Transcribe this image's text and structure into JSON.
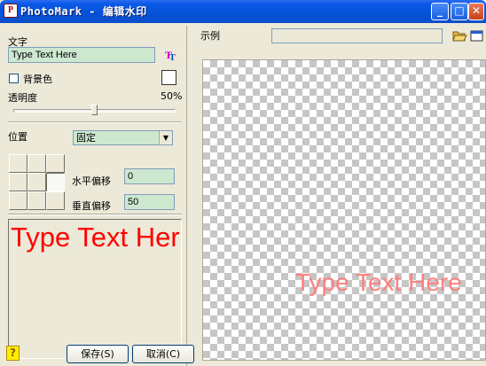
{
  "window": {
    "title": "PhotoMark - 编辑水印",
    "app_icon_letter": "P",
    "controls": {
      "minimize": "_",
      "maximize": "□",
      "close": "✕"
    }
  },
  "left": {
    "text_label": "文字",
    "text_value": "Type Text Here",
    "font_icon": "font-color-icon",
    "bg_color_label": "背景色",
    "bg_color_checked": false,
    "swatch_color": "#ffffff",
    "opacity_label": "透明度",
    "opacity_value": "50%",
    "opacity_fraction": 0.5,
    "position_label": "位置",
    "position_selected": "固定",
    "h_offset_label": "水平偏移",
    "h_offset_value": "0",
    "v_offset_label": "垂直偏移",
    "v_offset_value": "50",
    "preview_text": "Type Text Here",
    "preview_color": "#ff0000"
  },
  "buttons": {
    "help": "?",
    "save": "保存(S)",
    "cancel": "取消(C)"
  },
  "right": {
    "example_label": "示例",
    "example_path": "",
    "open_icon": "folder-open-icon",
    "window_icon": "window-icon",
    "watermark_text": "Type Text Here",
    "watermark_color": "#ff8080"
  }
}
